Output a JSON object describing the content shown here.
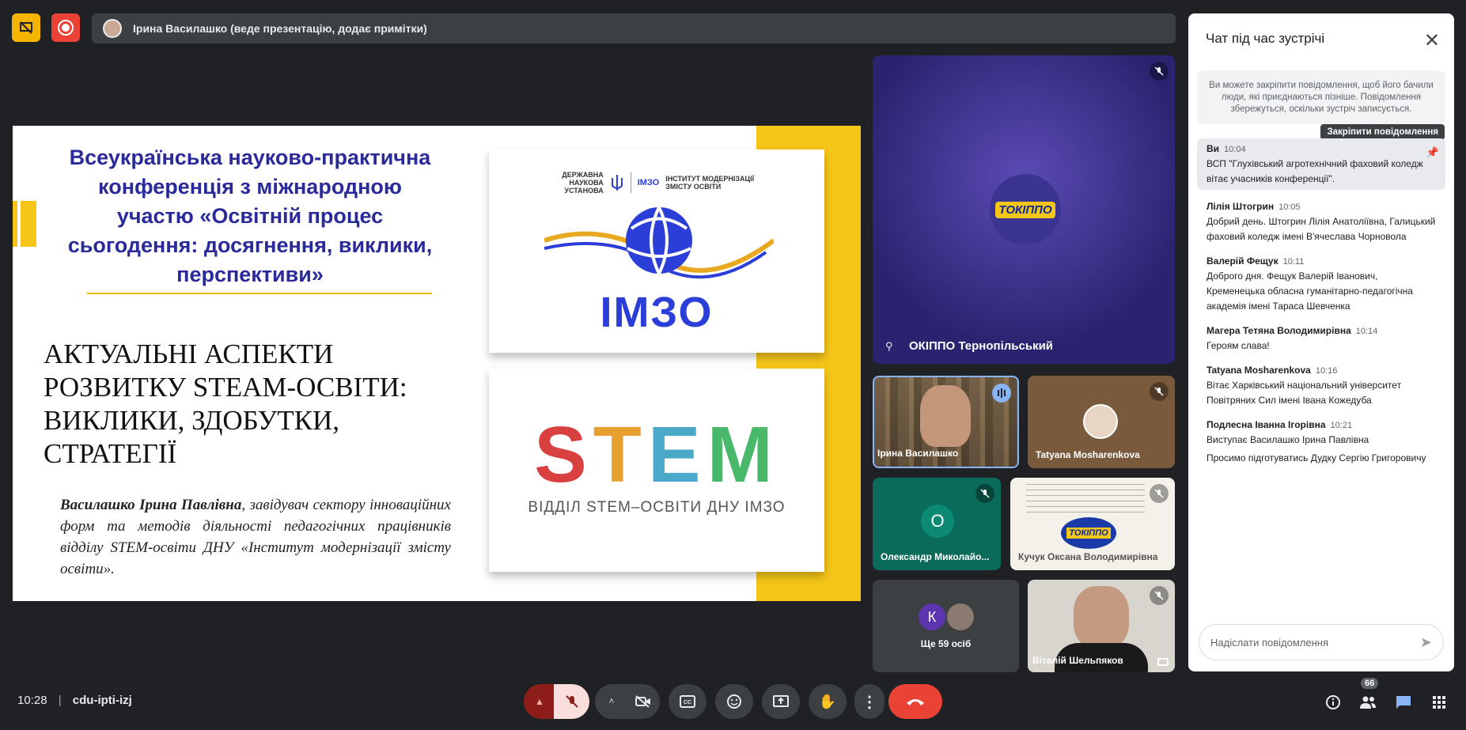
{
  "presenter_bar": {
    "text": "Ірина Василашко (веде презентацію, додає примітки)"
  },
  "slide": {
    "conference_title": "Всеукраїнська науково-практична конференція з міжнародною участю «Освітній процес сьогодення: досягнення, виклики, перспективи»",
    "talk_title": "АКТУАЛЬНІ АСПЕКТИ РОЗВИТКУ STEAM-ОСВІТИ: ВИКЛИКИ, ЗДОБУТКИ, СТРАТЕГІЇ",
    "author_name": "Василашко Ірина Павлівна",
    "author_rest": ", завідувач сектору інноваційних форм та методів діяльності педагогічних працівників відділу STEM-освіти ДНУ «Інститут модернізації змісту освіти».",
    "imzo_head_left": "ДЕРЖАВНА НАУКОВА УСТАНОВА",
    "imzo_head_mid": "ІМЗО",
    "imzo_head_right": "ІНСТИТУТ МОДЕРНІЗАЦІЇ ЗМІСТУ ОСВІТИ",
    "imzo_big": "ІМЗО",
    "stem_letters": [
      "S",
      "T",
      "E",
      "M"
    ],
    "stem_colors": [
      "#d94040",
      "#e8a030",
      "#4aa8c8",
      "#4ab86a"
    ],
    "stem_sub": "ВІДДІЛ STEM–ОСВІТИ ДНУ ІМЗО"
  },
  "tiles": {
    "main": {
      "name": "ОКІППО Тернопільський",
      "logo": "ТОКІППО"
    },
    "t1": {
      "name": "Ірина Василашко"
    },
    "t2": {
      "name": "Tatyana Mosharenkova"
    },
    "t3": {
      "name": "Олександр Миколайо...",
      "initial": "О"
    },
    "t4": {
      "name": "Кучук Оксана Володимирівна",
      "logo": "ТОКІППО"
    },
    "t5": {
      "name": "Ще 59 осіб",
      "initial": "К"
    },
    "t6": {
      "name": "Віталій Шельпяков"
    }
  },
  "chat": {
    "title": "Чат під час зустрічі",
    "info": "Ви можете закріпити повідомлення, щоб його бачили люди, які приєднаються пізніше. Повідомлення збережуться, оскільки зустріч записується.",
    "pin_tooltip": "Закріпити повідомлення",
    "messages": [
      {
        "who": "Ви",
        "time": "10:04",
        "lines": [
          "ВСП \"Глухівський агротехнічний фаховий коледж вітає учасників конференції\"."
        ]
      },
      {
        "who": "Лілія Штогрин",
        "time": "10:05",
        "lines": [
          "Добрий день. Штогрин Лілія Анатоліївна, Галицький фаховий коледж імені В'ячеслава Чорновола"
        ]
      },
      {
        "who": "Валерій Фещук",
        "time": "10:11",
        "lines": [
          "Доброго  дня. Фещук Валерій Іванович, Кременецька обласна гуманітарно-педагогічна академія імені Тараса Шевченка"
        ]
      },
      {
        "who": "Магера Тетяна Володимирівна",
        "time": "10:14",
        "lines": [
          "Героям слава!"
        ]
      },
      {
        "who": "Tatyana Mosharenkova",
        "time": "10:16",
        "lines": [
          "Вітає Харківський національний університет Повітряних Сил імені Івана Кожедуба"
        ]
      },
      {
        "who": "Подлесна Іванна Ігорівна",
        "time": "10:21",
        "lines": [
          "Виступає Василашко Ірина Павлівна",
          "Просимо підготуватись Дудку Сергію Григоровичу"
        ]
      }
    ],
    "input_placeholder": "Надіслати повідомлення"
  },
  "bottom": {
    "time": "10:28",
    "meeting_code": "cdu-ipti-izj",
    "people_count": "66"
  },
  "colors": {
    "accent_red": "#ea4335",
    "accent_yellow": "#f5c518",
    "blue": "#8ab4f8"
  }
}
